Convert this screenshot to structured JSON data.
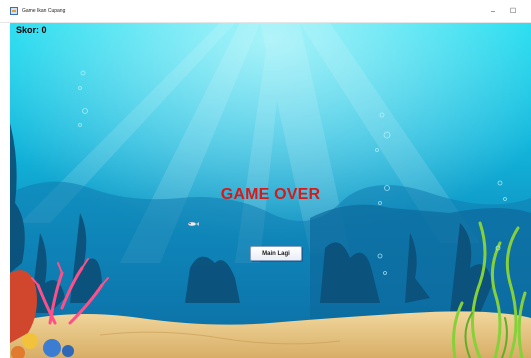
{
  "window": {
    "title": "Game Ikan Cupang",
    "minimize_glyph": "–",
    "maximize_glyph": "☐"
  },
  "hud": {
    "score_text": "Skor: 0"
  },
  "overlay": {
    "game_over_text": "GAME OVER",
    "replay_label": "Main Lagi"
  },
  "icons": {
    "app": "window-app-icon",
    "fish": "fish-sprite"
  },
  "colors": {
    "game_over": "#d41a1a",
    "water_top": "#0fd4ee",
    "water_bottom": "#0b5e9a",
    "sand": "#e8c98a"
  }
}
